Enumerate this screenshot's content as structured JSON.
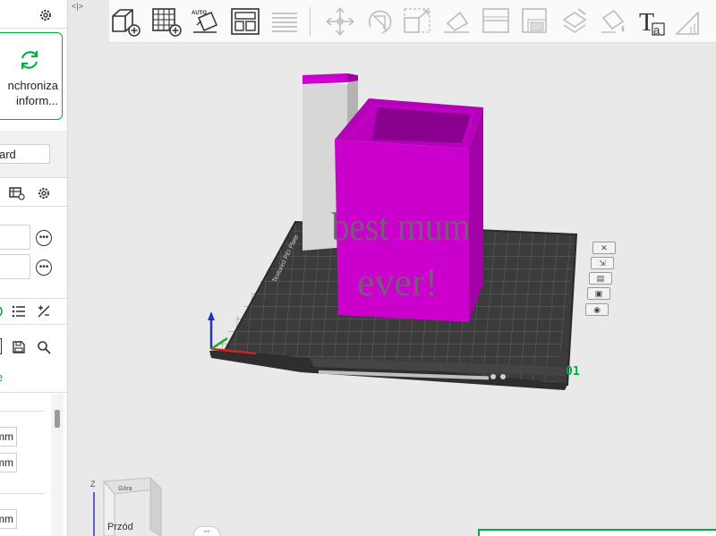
{
  "sidebar": {
    "sync_text_line1": "nchroniza",
    "sync_text_line2": "inform...",
    "preset_value": "ard",
    "mm_unit": "mm"
  },
  "toolbar": {
    "auto_label": "AUTO",
    "text_tool_label": "T"
  },
  "viewport": {
    "model_text_line1": "best mum",
    "model_text_line2": "ever!",
    "plate_number": "01",
    "cube_top": "Góra",
    "cube_front": "Przód",
    "axis_z": "Z"
  },
  "colors": {
    "accent": "#00ae42",
    "model_magenta": "#cc00cc",
    "plate": "#3a3a3a",
    "tower": "#d9d9d9"
  },
  "icons": [
    "gear-icon",
    "sync-icon",
    "dots-icon",
    "list-icon",
    "swap-icon",
    "save-icon",
    "search-icon"
  ]
}
